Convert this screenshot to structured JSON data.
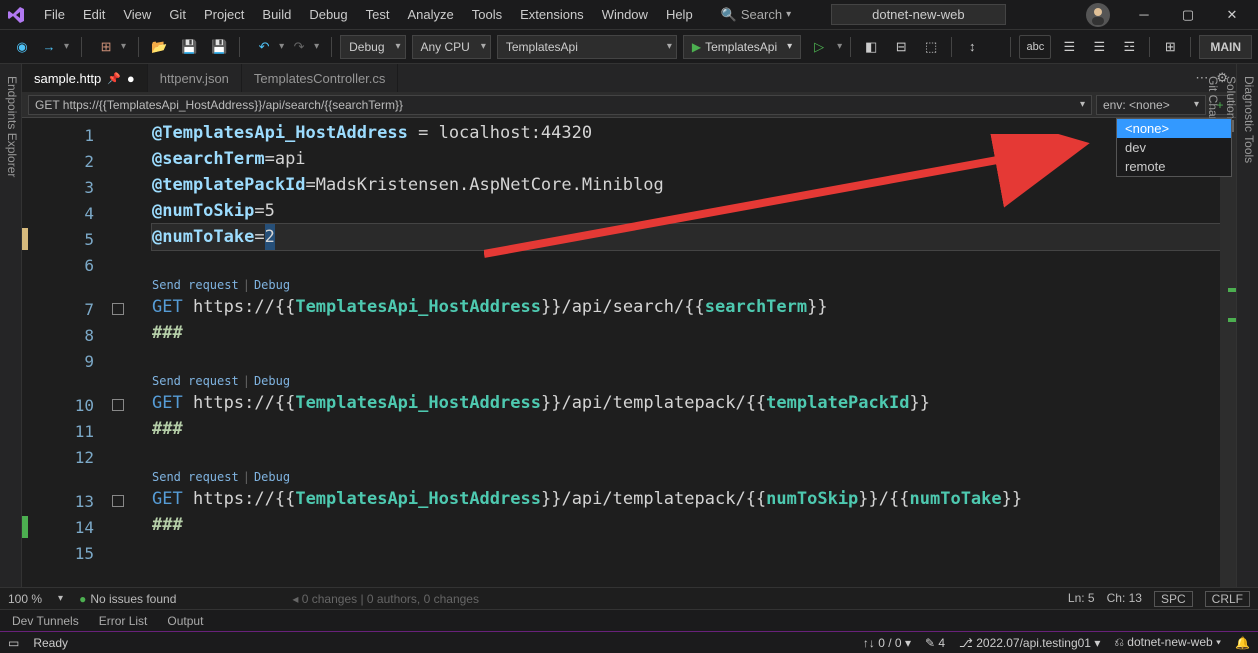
{
  "menu": {
    "file": "File",
    "edit": "Edit",
    "view": "View",
    "git": "Git",
    "project": "Project",
    "build": "Build",
    "debug": "Debug",
    "test": "Test",
    "analyze": "Analyze",
    "tools": "Tools",
    "extensions": "Extensions",
    "window": "Window",
    "help": "Help",
    "search": "Search"
  },
  "solution_name": "dotnet-new-web",
  "toolbar": {
    "config": "Debug",
    "platform": "Any CPU",
    "startup": "TemplatesApi",
    "run": "TemplatesApi",
    "main": "MAIN",
    "abc": "abc"
  },
  "left_panel": "Endpoints Explorer",
  "right_panels": {
    "diag": "Diagnostic Tools",
    "sol": "Solution Explorer",
    "git": "Git Changes"
  },
  "tabs": {
    "t1": "sample.http",
    "t2": "httpenv.json",
    "t3": "TemplatesController.cs"
  },
  "nav_crumb": "GET https://{{TemplatesApi_HostAddress}}/api/search/{{searchTerm}}",
  "env_label": "env: <none>",
  "env_options": {
    "none": "<none>",
    "dev": "dev",
    "remote": "remote"
  },
  "codelens": {
    "send": "Send request",
    "debug": "Debug"
  },
  "lines": {
    "l1_var": "@TemplatesApi_HostAddress",
    "l1_rest": " = localhost:44320",
    "l2_var": "@searchTerm",
    "l2_rest": "=api",
    "l3_var": "@templatePackId",
    "l3_rest": "=MadsKristensen.AspNetCore.Miniblog",
    "l4_var": "@numToSkip",
    "l4_rest": "=5",
    "l5_var": "@numToTake",
    "l5_eq": "=",
    "l5_val": "2",
    "l7_kw": "GET ",
    "l7_scheme": "https://",
    "l7_b1": "{{",
    "l7_p1": "TemplatesApi_HostAddress",
    "l7_b2": "}}",
    "l7_mid": "/api/search/",
    "l7_b3": "{{",
    "l7_p2": "searchTerm",
    "l7_b4": "}}",
    "l8": "###",
    "l10_kw": "GET ",
    "l10_scheme": "https://",
    "l10_b1": "{{",
    "l10_p1": "TemplatesApi_HostAddress",
    "l10_b2": "}}",
    "l10_mid": "/api/templatepack/",
    "l10_b3": "{{",
    "l10_p2": "templatePackId",
    "l10_b4": "}}",
    "l11": "###",
    "l13_kw": "GET ",
    "l13_scheme": "https://",
    "l13_b1": "{{",
    "l13_p1": "TemplatesApi_HostAddress",
    "l13_b2": "}}",
    "l13_mid": "/api/templatepack/",
    "l13_b3": "{{",
    "l13_p2": "numToSkip",
    "l13_b4": "}}",
    "l13_mid2": "/",
    "l13_b5": "{{",
    "l13_p3": "numToTake",
    "l13_b6": "}}",
    "l14": "###"
  },
  "line_numbers": {
    "n1": "1",
    "n2": "2",
    "n3": "3",
    "n4": "4",
    "n5": "5",
    "n6": "6",
    "n7": "7",
    "n8": "8",
    "n9": "9",
    "n10": "10",
    "n11": "11",
    "n12": "12",
    "n13": "13",
    "n14": "14",
    "n15": "15"
  },
  "editor_status": {
    "zoom": "100 %",
    "issues": "No issues found",
    "changes": "0  changes | 0  authors,  0  changes",
    "ln": "Ln: 5",
    "ch": "Ch: 13",
    "spc": "SPC",
    "crlf": "CRLF"
  },
  "bottom_tabs": {
    "dev": "Dev Tunnels",
    "err": "Error List",
    "out": "Output"
  },
  "vs_status": {
    "ready": "Ready",
    "updown": "0 / 0",
    "pen": "4",
    "repo": "2022.07/api.testing01",
    "branch": "dotnet-new-web"
  }
}
